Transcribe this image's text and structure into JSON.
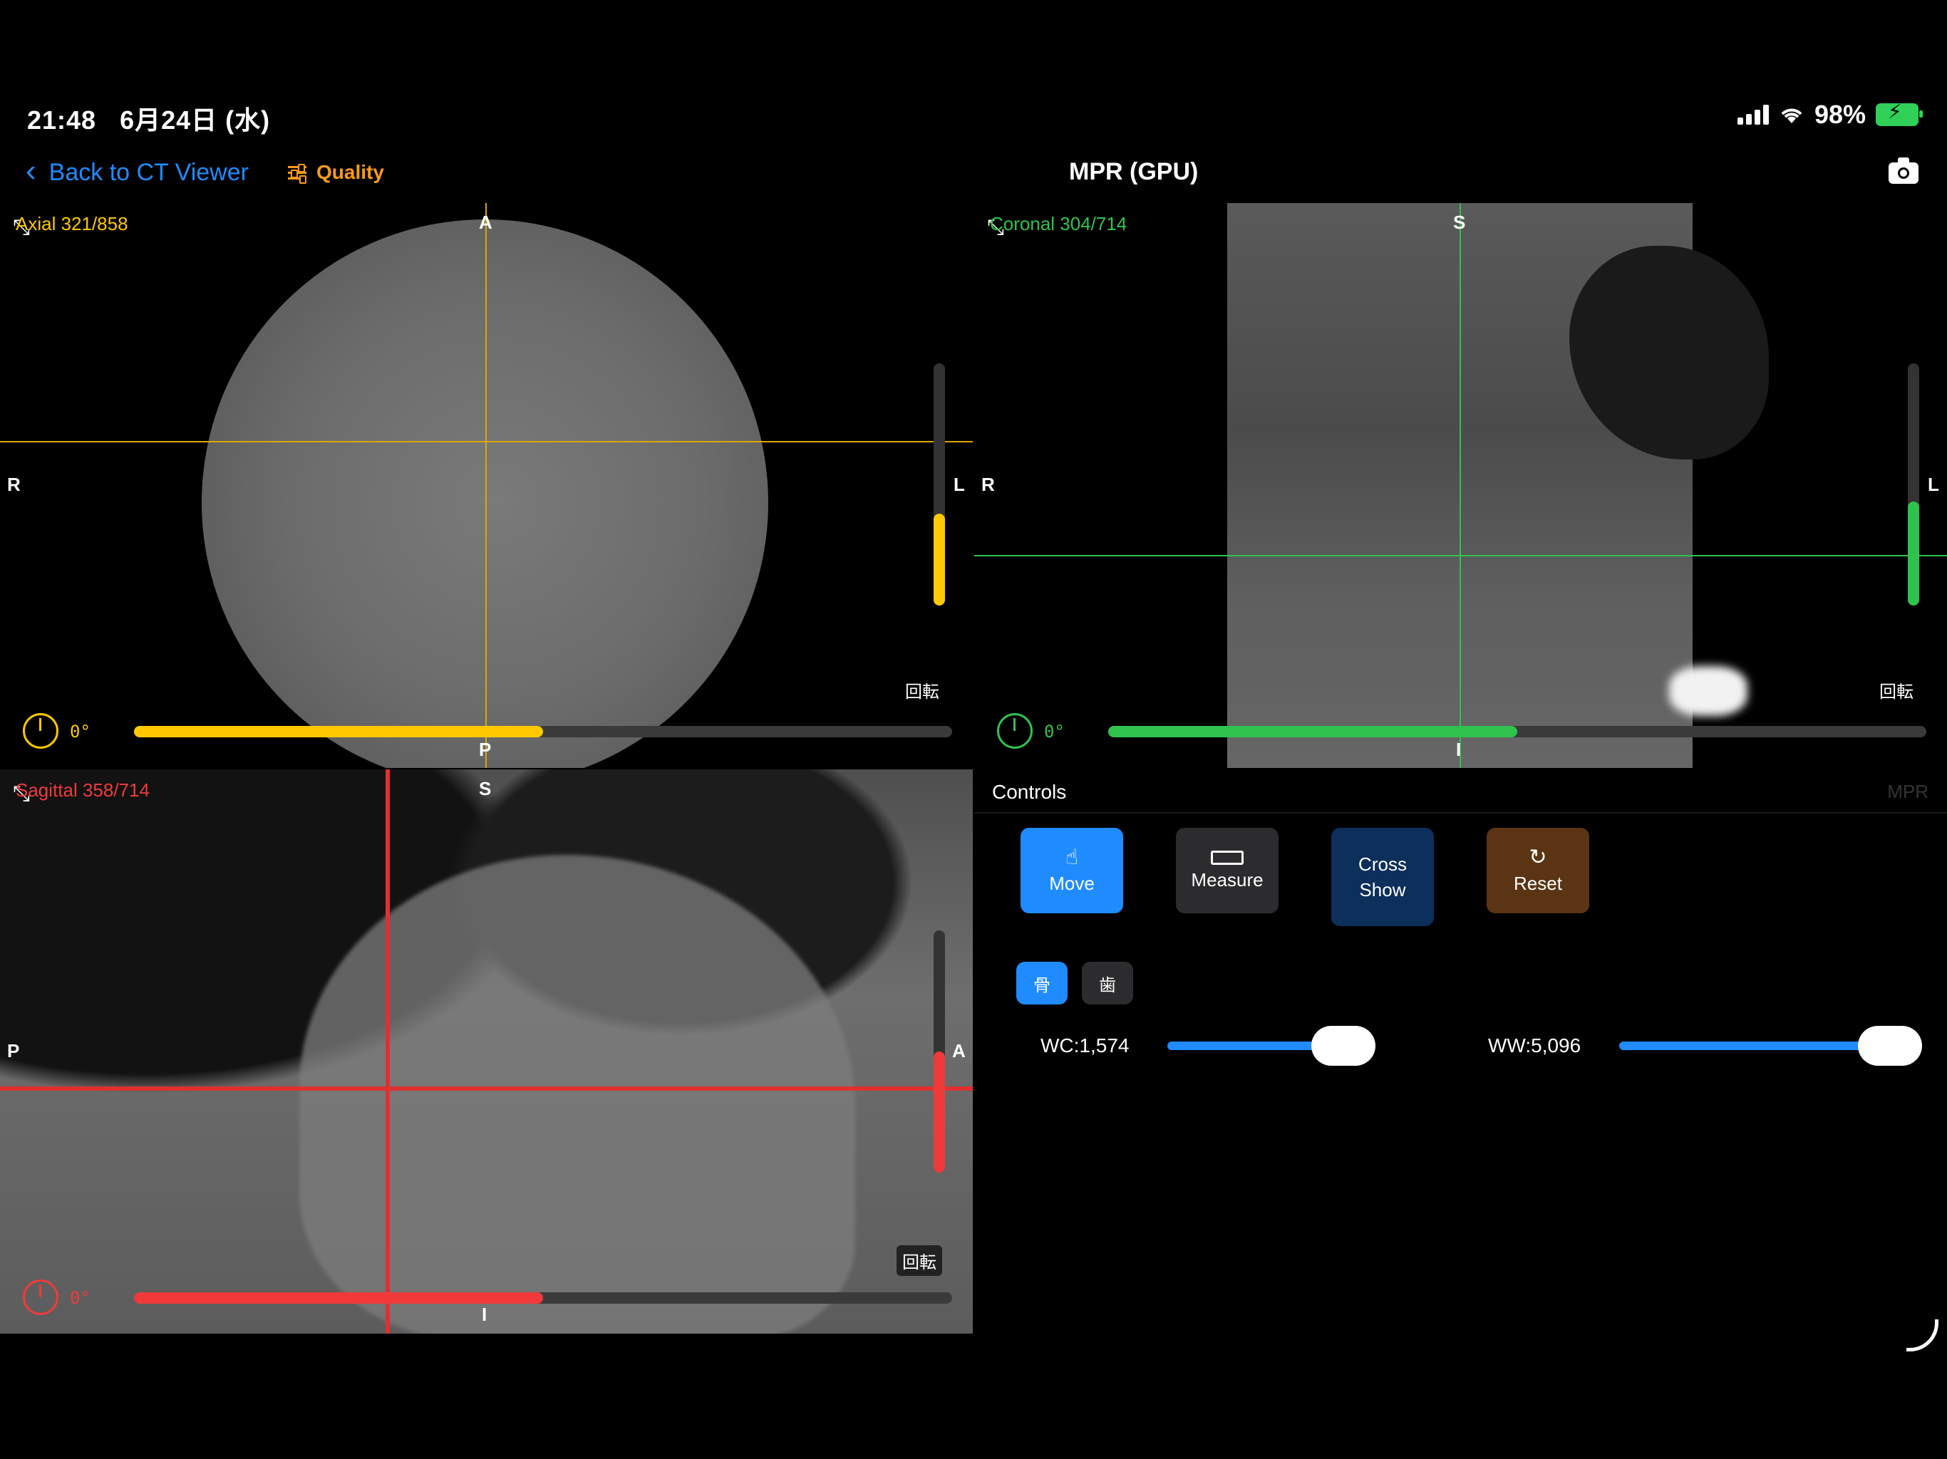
{
  "status": {
    "time": "21:48",
    "date": "6月24日 (水)",
    "battery": "98%"
  },
  "nav": {
    "back_label": "Back to CT Viewer",
    "quality_label": "Quality",
    "title": "MPR (GPU)"
  },
  "colors": {
    "accent": "#1f8bff",
    "quality": "#ff9a1a",
    "axial": "#ffc800",
    "coronal": "#2fc34d",
    "sagittal": "#f03a3a"
  },
  "axial": {
    "label": "Axial 321/858",
    "orient": {
      "top": "A",
      "bottom": "P",
      "left": "R",
      "right": "L"
    },
    "rotate_label": "回転",
    "angle": "0°",
    "level_fraction": 0.38,
    "slider_fraction": 0.5
  },
  "coronal": {
    "label": "Coronal 304/714",
    "orient": {
      "top": "S",
      "bottom": "I",
      "left": "R",
      "right": "L"
    },
    "rotate_label": "回転",
    "angle": "0°",
    "level_fraction": 0.43,
    "slider_fraction": 0.5
  },
  "sagittal": {
    "label": "Sagittal 358/714",
    "orient": {
      "top": "S",
      "bottom": "I",
      "left": "P",
      "right": "A"
    },
    "rotate_label": "回転",
    "angle": "0°",
    "level_fraction": 0.5,
    "slider_fraction": 0.5
  },
  "controls": {
    "title": "Controls",
    "right_label": "MPR",
    "tools": [
      {
        "label": "Move",
        "icon": "hand-icon"
      },
      {
        "label": "Measure",
        "icon": "ruler-icon"
      },
      {
        "label": "Cross Show",
        "icon": ""
      },
      {
        "label": "Reset",
        "icon": "reset-icon"
      }
    ],
    "presets": [
      "骨",
      "歯"
    ],
    "wc_label": "WC:1,574",
    "ww_label": "WW:5,096",
    "wc_fraction": 0.85,
    "ww_fraction": 0.95
  }
}
